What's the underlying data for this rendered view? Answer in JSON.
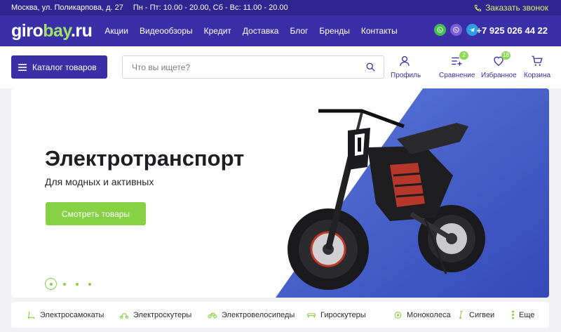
{
  "topbar": {
    "address": "Москва, ул. Поликарпова, д. 27",
    "hours": "Пн - Пт: 10.00 - 20.00, Сб - Вс: 11.00 - 20.00",
    "callback": "Заказать звонок"
  },
  "header": {
    "logo_part1": "giro",
    "logo_part2": "bay",
    "logo_part3": ".ru",
    "nav": [
      "Акции",
      "Видеообзоры",
      "Кредит",
      "Доставка",
      "Блог",
      "Бренды",
      "Контакты"
    ],
    "phone": "+7 925 026 44 22"
  },
  "searchbar": {
    "catalog_label": "Каталог товаров",
    "placeholder": "Что вы ищете?"
  },
  "tools": {
    "profile": "Профиль",
    "compare": "Сравнение",
    "compare_count": "2",
    "favorites": "Избранное",
    "favorites_count": "18",
    "cart": "Корзина"
  },
  "banner": {
    "title": "Электротранспорт",
    "subtitle": "Для модных и активных",
    "button": "Смотреть товары",
    "slides_total": 4,
    "active_slide": 1
  },
  "categories": [
    "Электросамокаты",
    "Электроскутеры",
    "Электровелосипеды",
    "Гироскутеры",
    "Моноколеса",
    "Сигвеи",
    "Еще"
  ],
  "colors": {
    "primary": "#3a2fa6",
    "accent": "#86d144",
    "topbar": "#2f2490",
    "callback": "#d9f36a"
  }
}
